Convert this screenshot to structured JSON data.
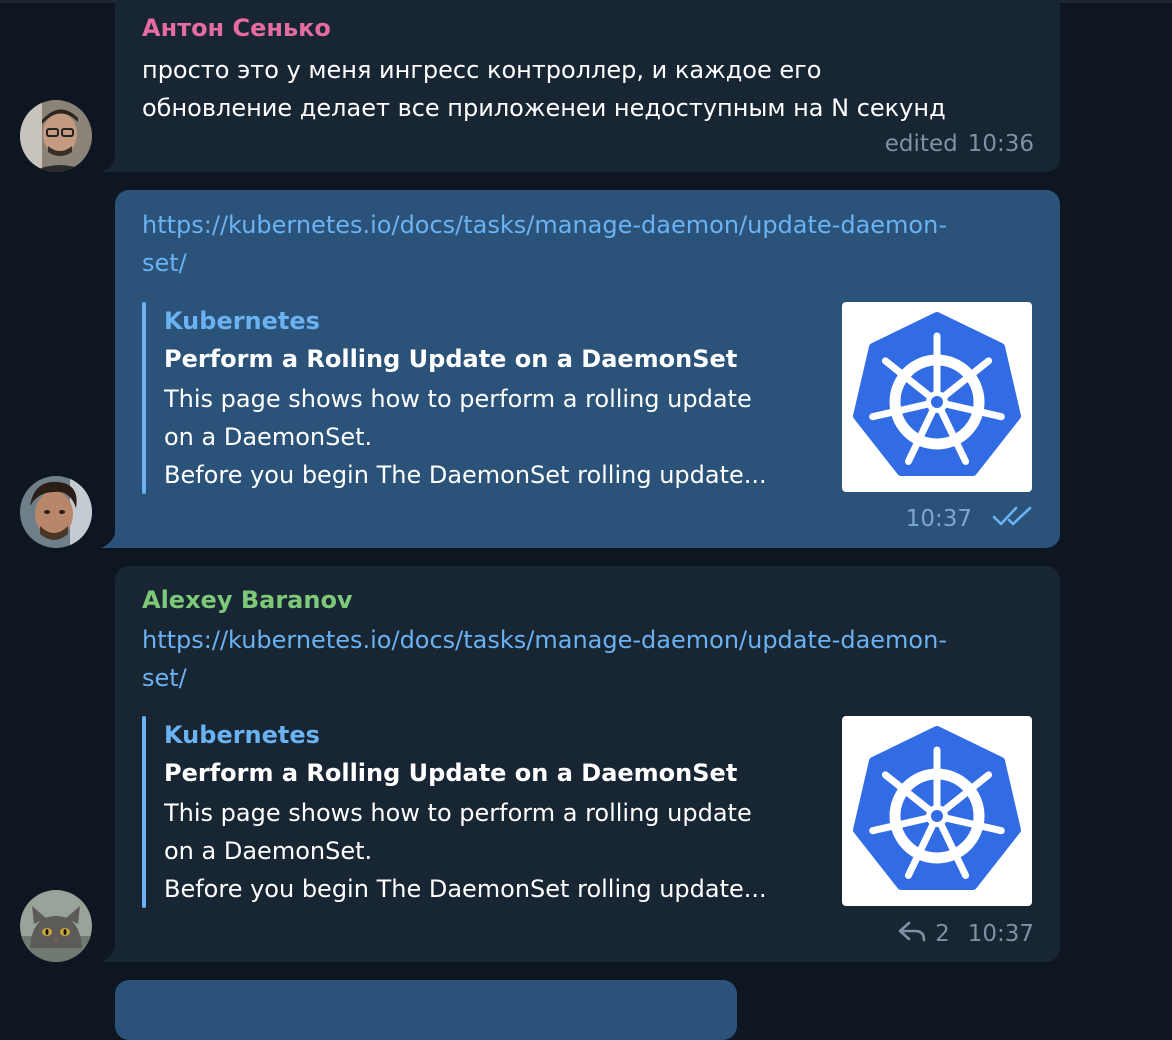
{
  "colors": {
    "background": "#0e1621",
    "incoming_bubble": "#182533",
    "outgoing_bubble": "#2b5278",
    "link": "#6ab2f2",
    "author_anton": "#e56ca0",
    "author_alexey": "#7ec87a",
    "meta": "#7f91a4"
  },
  "messages": [
    {
      "author": "Антон Сенько",
      "lines": [
        "просто это у меня ингресс контроллер, и каждое его",
        "обновление делает все приложенеи недоступным на N секунд"
      ],
      "edited": "edited",
      "time": "10:36",
      "avatar_icon": "user-avatar-anton"
    },
    {
      "link_lines": [
        "https://kubernetes.io/docs/tasks/manage-daemon/update-daemon-",
        "set/"
      ],
      "preview": {
        "site": "Kubernetes",
        "title": "Perform a Rolling Update on a DaemonSet",
        "desc_lines": [
          "This page shows how to perform a rolling update",
          "on a DaemonSet.",
          "Before you begin  The DaemonSet rolling update..."
        ],
        "thumb_icon": "kubernetes-logo"
      },
      "time": "10:37",
      "status_icon": "double-check-icon",
      "avatar_icon": "user-avatar-self"
    },
    {
      "author": "Alexey Baranov",
      "link_lines": [
        "https://kubernetes.io/docs/tasks/manage-daemon/update-daemon-",
        "set/"
      ],
      "preview": {
        "site": "Kubernetes",
        "title": "Perform a Rolling Update on a DaemonSet",
        "desc_lines": [
          "This page shows how to perform a rolling update",
          "on a DaemonSet.",
          "Before you begin  The DaemonSet rolling update..."
        ],
        "thumb_icon": "kubernetes-logo"
      },
      "replies_icon": "reply-arrow-icon",
      "replies": "2",
      "time": "10:37",
      "avatar_icon": "user-avatar-cat"
    }
  ]
}
